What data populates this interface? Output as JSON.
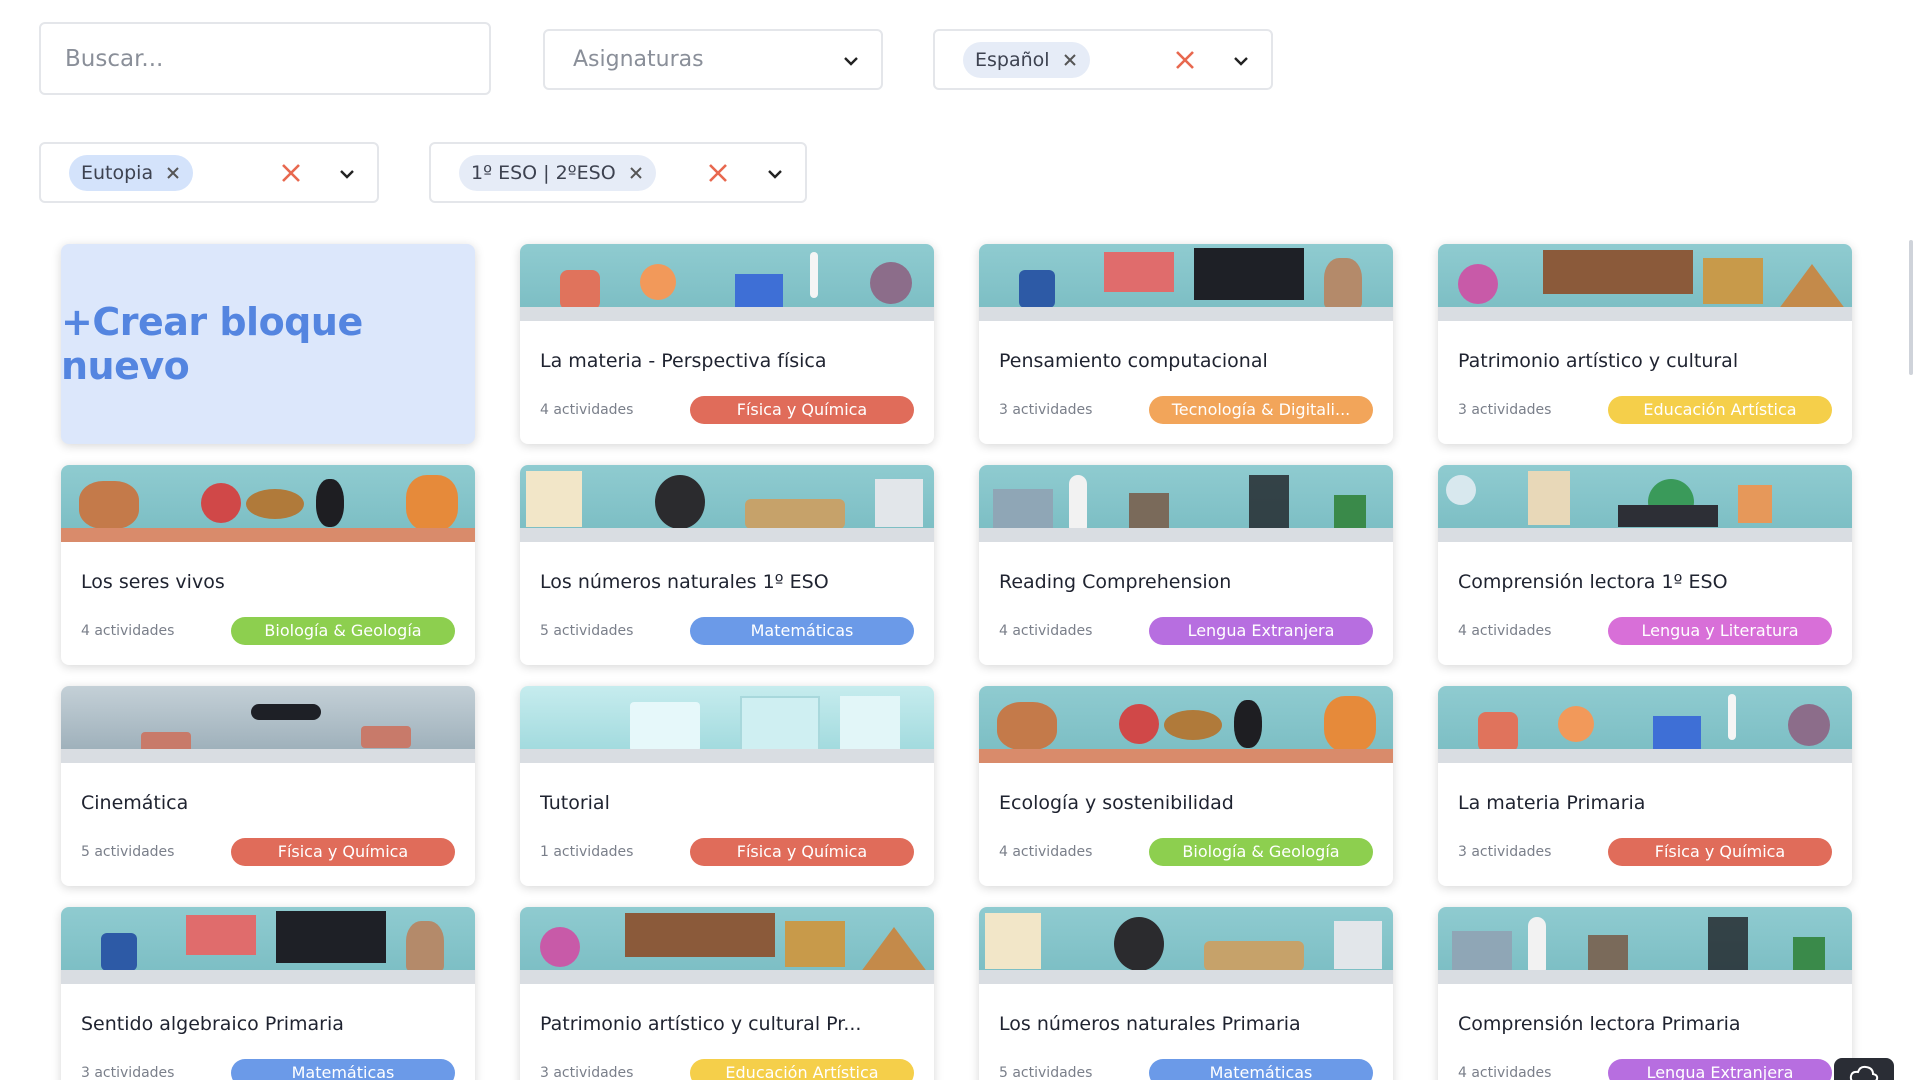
{
  "filters": {
    "search_placeholder": "Buscar...",
    "subjects_placeholder": "Asignaturas",
    "language_chip": "Español",
    "publisher_chip": "Eutopia",
    "level_chip": "1º ESO | 2ºESO"
  },
  "create_card": {
    "label": "+Crear bloque nuevo"
  },
  "colors": {
    "fisica": "#e06c5a",
    "tecnologia": "#f2a55a",
    "artistica": "#f5cf4a",
    "biologia": "#8dcf4f",
    "matematicas": "#6b9ae8",
    "lengua_extranjera": "#b76ee0",
    "lengua_literatura": "#d86fd8"
  },
  "cards": [
    {
      "title": "La materia - Perspectiva física",
      "count": "4 actividades",
      "tag": "Física y Química",
      "tag_color": "#e06c5a",
      "banner": "science"
    },
    {
      "title": "Pensamiento computacional",
      "count": "3 actividades",
      "tag": "Tecnología & Digitali...",
      "tag_color": "#f2a55a",
      "banner": "tech"
    },
    {
      "title": "Patrimonio artístico y cultural",
      "count": "3 actividades",
      "tag": "Educación Artística",
      "tag_color": "#f5cf4a",
      "banner": "art"
    },
    {
      "title": "Los seres vivos",
      "count": "4 actividades",
      "tag": "Biología & Geología",
      "tag_color": "#8dcf4f",
      "banner": "animals"
    },
    {
      "title": "Los números naturales 1º ESO",
      "count": "5 actividades",
      "tag": "Matemáticas",
      "tag_color": "#6b9ae8",
      "banner": "math"
    },
    {
      "title": "Reading Comprehension",
      "count": "4 actividades",
      "tag": "Lengua Extranjera",
      "tag_color": "#b76ee0",
      "banner": "city"
    },
    {
      "title": "Comprensión lectora 1º ESO",
      "count": "4 actividades",
      "tag": "Lengua y Literatura",
      "tag_color": "#d86fd8",
      "banner": "night"
    },
    {
      "title": "Cinemática",
      "count": "5 actividades",
      "tag": "Física y Química",
      "tag_color": "#e06c5a",
      "banner": "motion"
    },
    {
      "title": "Tutorial",
      "count": "1 actividades",
      "tag": "Física y Química",
      "tag_color": "#e06c5a",
      "banner": "ice"
    },
    {
      "title": "Ecología y sostenibilidad",
      "count": "4 actividades",
      "tag": "Biología & Geología",
      "tag_color": "#8dcf4f",
      "banner": "animals"
    },
    {
      "title": "La materia Primaria",
      "count": "3 actividades",
      "tag": "Física y Química",
      "tag_color": "#e06c5a",
      "banner": "science"
    },
    {
      "title": "Sentido algebraico Primaria",
      "count": "3 actividades",
      "tag": "Matemáticas",
      "tag_color": "#6b9ae8",
      "banner": "tech"
    },
    {
      "title": "Patrimonio artístico y cultural Pr...",
      "count": "3 actividades",
      "tag": "Educación Artística",
      "tag_color": "#f5cf4a",
      "banner": "art"
    },
    {
      "title": "Los números naturales Primaria",
      "count": "5 actividades",
      "tag": "Matemáticas",
      "tag_color": "#6b9ae8",
      "banner": "math"
    },
    {
      "title": "Comprensión lectora Primaria",
      "count": "4 actividades",
      "tag": "Lengua Extranjera",
      "tag_color": "#b76ee0",
      "banner": "city"
    }
  ]
}
